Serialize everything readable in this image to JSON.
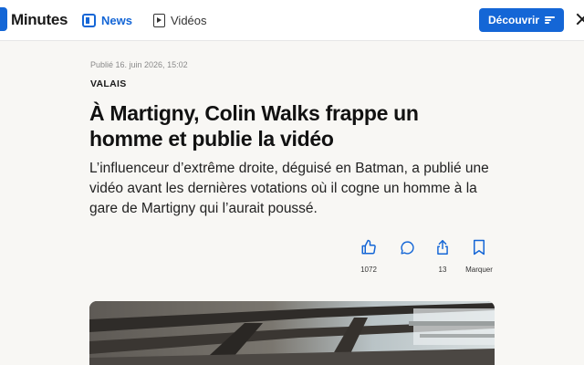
{
  "header": {
    "logo_text": "Minutes",
    "nav": [
      {
        "label": "News",
        "icon": "news-icon",
        "active": true
      },
      {
        "label": "Vidéos",
        "icon": "video-icon",
        "active": false
      }
    ],
    "discover_label": "Découvrir",
    "accent_color": "#1466d6"
  },
  "article": {
    "published": "Publié 16. juin 2026, 15:02",
    "category": "VALAIS",
    "headline": "À Martigny, Colin Walks frappe un homme et publie la vidéo",
    "lead": "L’influenceur d’extrême droite, déguisé en Batman, a publié une vidéo avant les dernières votations où il cogne un homme à la gare de Martigny qui l’aurait poussé.",
    "actions": {
      "like_count": "1072",
      "comment_count": "",
      "share_count": "13",
      "save_label": "Marquer"
    }
  }
}
